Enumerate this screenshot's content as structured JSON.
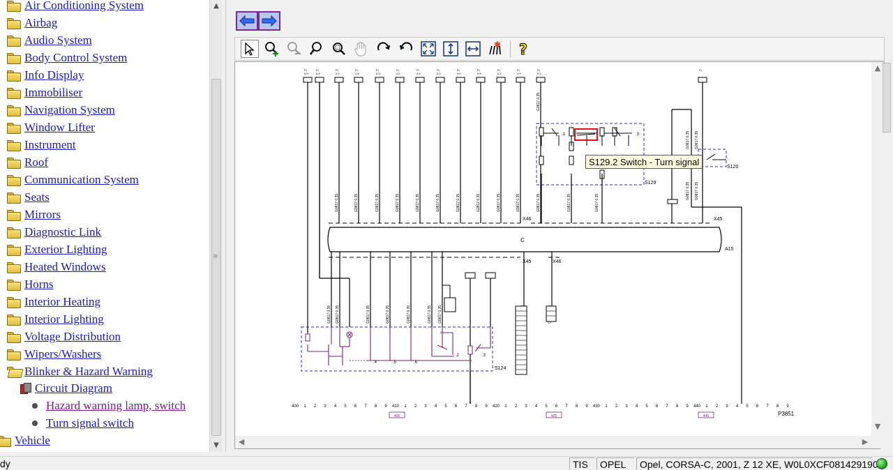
{
  "tree": {
    "items": [
      {
        "label": "Air Conditioning System"
      },
      {
        "label": "Airbag"
      },
      {
        "label": "Audio System"
      },
      {
        "label": "Body Control System"
      },
      {
        "label": "Info Display"
      },
      {
        "label": "Immobiliser"
      },
      {
        "label": "Navigation System"
      },
      {
        "label": "Window Lifter"
      },
      {
        "label": "Instrument"
      },
      {
        "label": "Roof"
      },
      {
        "label": "Communication System"
      },
      {
        "label": "Seats"
      },
      {
        "label": "Mirrors"
      },
      {
        "label": "Diagnostic Link"
      },
      {
        "label": "Exterior Lighting"
      },
      {
        "label": "Heated Windows"
      },
      {
        "label": "Horns"
      },
      {
        "label": "Interior Heating"
      },
      {
        "label": "Interior Lighting"
      },
      {
        "label": "Voltage Distribution"
      },
      {
        "label": "Wipers/Washers"
      },
      {
        "label": "Blinker & Hazard Warning"
      }
    ],
    "circuit_diagram": {
      "label": "Circuit Diagram"
    },
    "diagrams": [
      {
        "label": "Hazard warning lamp, switch"
      },
      {
        "label": "Turn signal switch"
      }
    ],
    "vehicle": {
      "label": "Vehicle"
    }
  },
  "toolbar": {
    "tools": [
      "pointer-icon",
      "zoom-in-icon",
      "zoom-out-icon",
      "zoom-icon",
      "zoom-area-icon",
      "pan-hand-icon",
      "rotate-cw-icon",
      "rotate-ccw-icon",
      "fit-page-icon",
      "fit-height-icon",
      "fit-width-icon",
      "highlight-icon",
      "help-icon"
    ]
  },
  "diagram": {
    "tooltip": "S129.2 Switch - Turn signal",
    "connectors": {
      "x46_top": "X46",
      "x45_top": "X45",
      "x45_bot": "X45",
      "x46_bot": "X46"
    },
    "components": {
      "a15": "A15",
      "s129": "S129",
      "s120": "S120",
      "s124": "S124"
    },
    "page_ref": "P3851",
    "grid_labels": [
      "400",
      "410",
      "420",
      "430",
      "440"
    ],
    "ruler_digits": [
      "1",
      "2",
      "3",
      "4",
      "5",
      "6",
      "7",
      "8",
      "9"
    ],
    "switch_positions": [
      ".1",
      ".2",
      ".3",
      ".4",
      ".5",
      ".6"
    ],
    "bottom_ref_labels": [
      "406",
      "425",
      "445"
    ]
  },
  "status": {
    "left": "dy",
    "tis": "TIS",
    "opel": "OPEL",
    "vehicle": "Opel, CORSA-C, 2001, Z 12 XE, W0L0XCF0814291908"
  },
  "colors": {
    "link": "#1a1ab0",
    "visited": "#7a1a8a",
    "wire": "#000000",
    "purple_wire": "#7a1f7a",
    "dash_blue": "#2a2aa8",
    "highlight": "#e01010"
  }
}
